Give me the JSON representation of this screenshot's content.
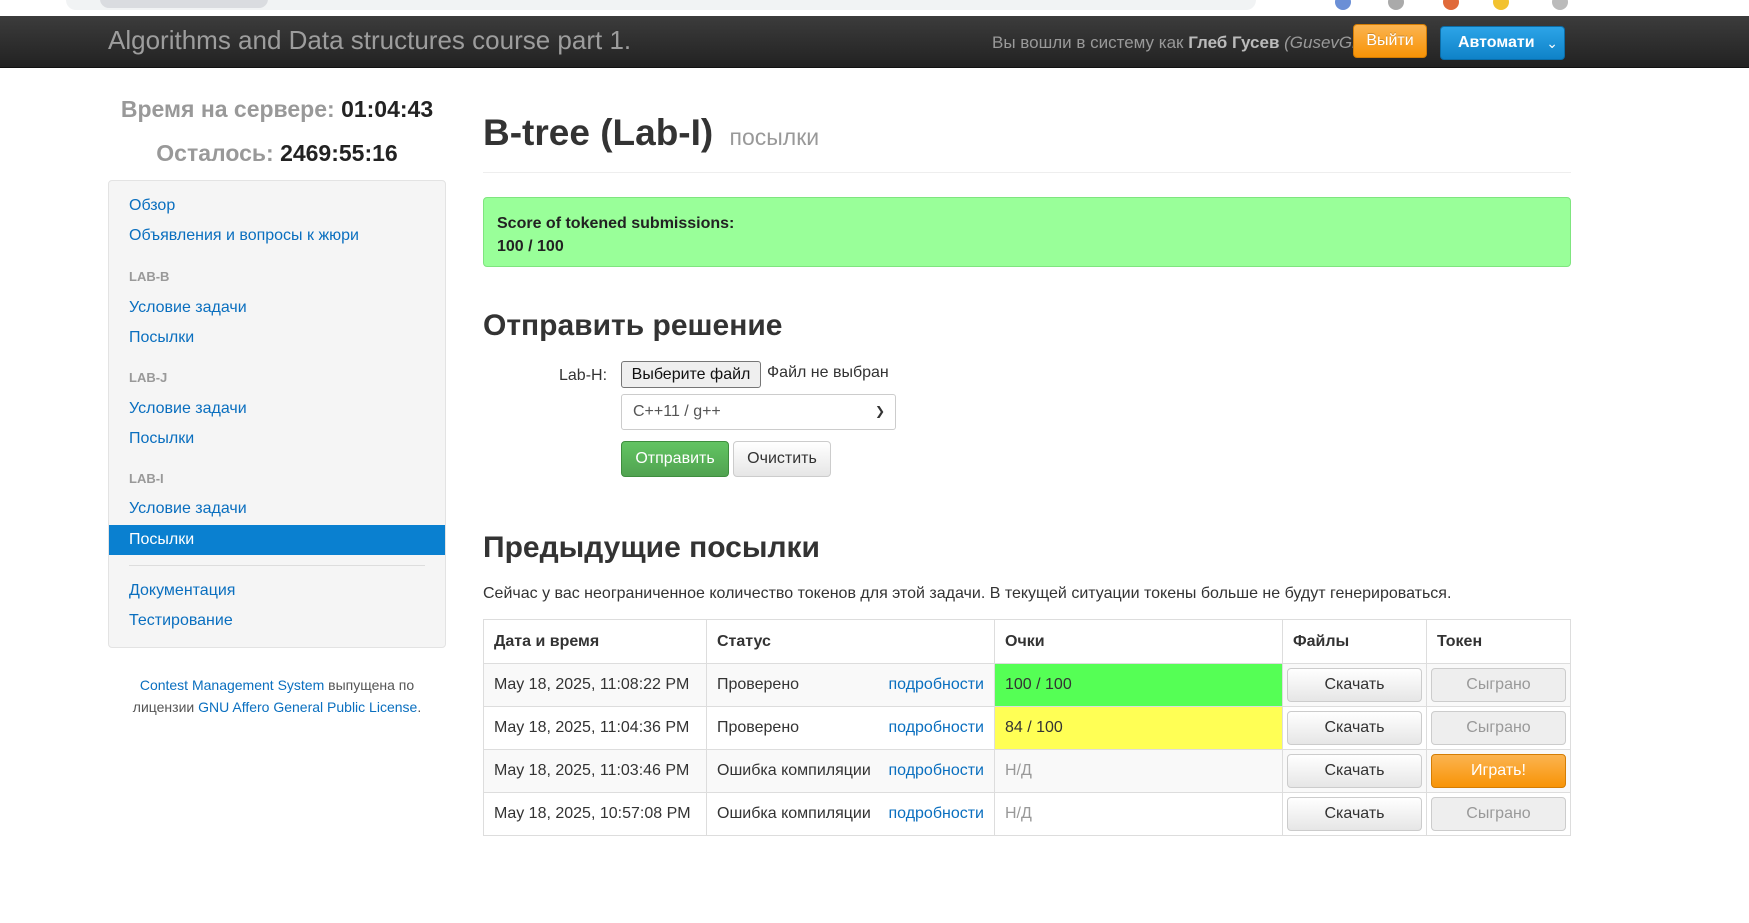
{
  "navbar": {
    "brand": "Algorithms and Data structures course part 1.",
    "login_prefix": "Вы вошли в систему как",
    "user_name": "Глеб Гусев",
    "user_login": "(GusevGl)",
    "logout_label": "Выйти",
    "language_label": "Автомати"
  },
  "clock": {
    "server_time_label": "Время на сервере:",
    "server_time": "01:04:43",
    "remaining_label": "Осталось:",
    "remaining": "2469:55:16"
  },
  "sidebar": {
    "overview": "Обзор",
    "announcements": "Объявления и вопросы к жюри",
    "task_groups": [
      {
        "header": "LAB-B",
        "statement": "Условие задачи",
        "submissions": "Посылки"
      },
      {
        "header": "LAB-J",
        "statement": "Условие задачи",
        "submissions": "Посылки"
      },
      {
        "header": "LAB-I",
        "statement": "Условие задачи",
        "submissions": "Посылки"
      }
    ],
    "documentation": "Документация",
    "testing": "Тестирование"
  },
  "footer": {
    "cms_link": "Contest Management System",
    "text_1": "выпущена по",
    "text_2": "лицензии",
    "license_link": "GNU Affero General Public License",
    "end": "."
  },
  "main": {
    "title": "B-tree (Lab-I)",
    "title_small": "посылки",
    "score_label": "Score of tokened submissions:",
    "score_value": "100 / 100",
    "submit_heading": "Отправить решение",
    "file_label": "Lab-H:",
    "file_button": "Выберите файл",
    "file_status": "Файл не выбран",
    "language_selected": "C++11 / g++",
    "submit_button": "Отправить",
    "reset_button": "Очистить",
    "previous_heading": "Предыдущие посылки",
    "token_note": "Сейчас у вас неограниченное количество токенов для этой задачи. В текущей ситуации токены больше не будут генерироваться."
  },
  "table": {
    "headers": {
      "date": "Дата и время",
      "status": "Статус",
      "score": "Очки",
      "files": "Файлы",
      "token": "Токен"
    },
    "details_label": "подробности",
    "download_label": "Скачать",
    "rows": [
      {
        "date": "May 18, 2025, 11:08:22 PM",
        "status": "Проверено",
        "score": "100 / 100",
        "token": "Сыграно"
      },
      {
        "date": "May 18, 2025, 11:04:36 PM",
        "status": "Проверено",
        "score": "84 / 100",
        "token": "Сыграно"
      },
      {
        "date": "May 18, 2025, 11:03:46 PM",
        "status": "Ошибка компиляции",
        "score": "Н/Д",
        "token": "Играть!"
      },
      {
        "date": "May 18, 2025, 10:57:08 PM",
        "status": "Ошибка компиляции",
        "score": "Н/Д",
        "token": "Сыграно"
      }
    ]
  }
}
